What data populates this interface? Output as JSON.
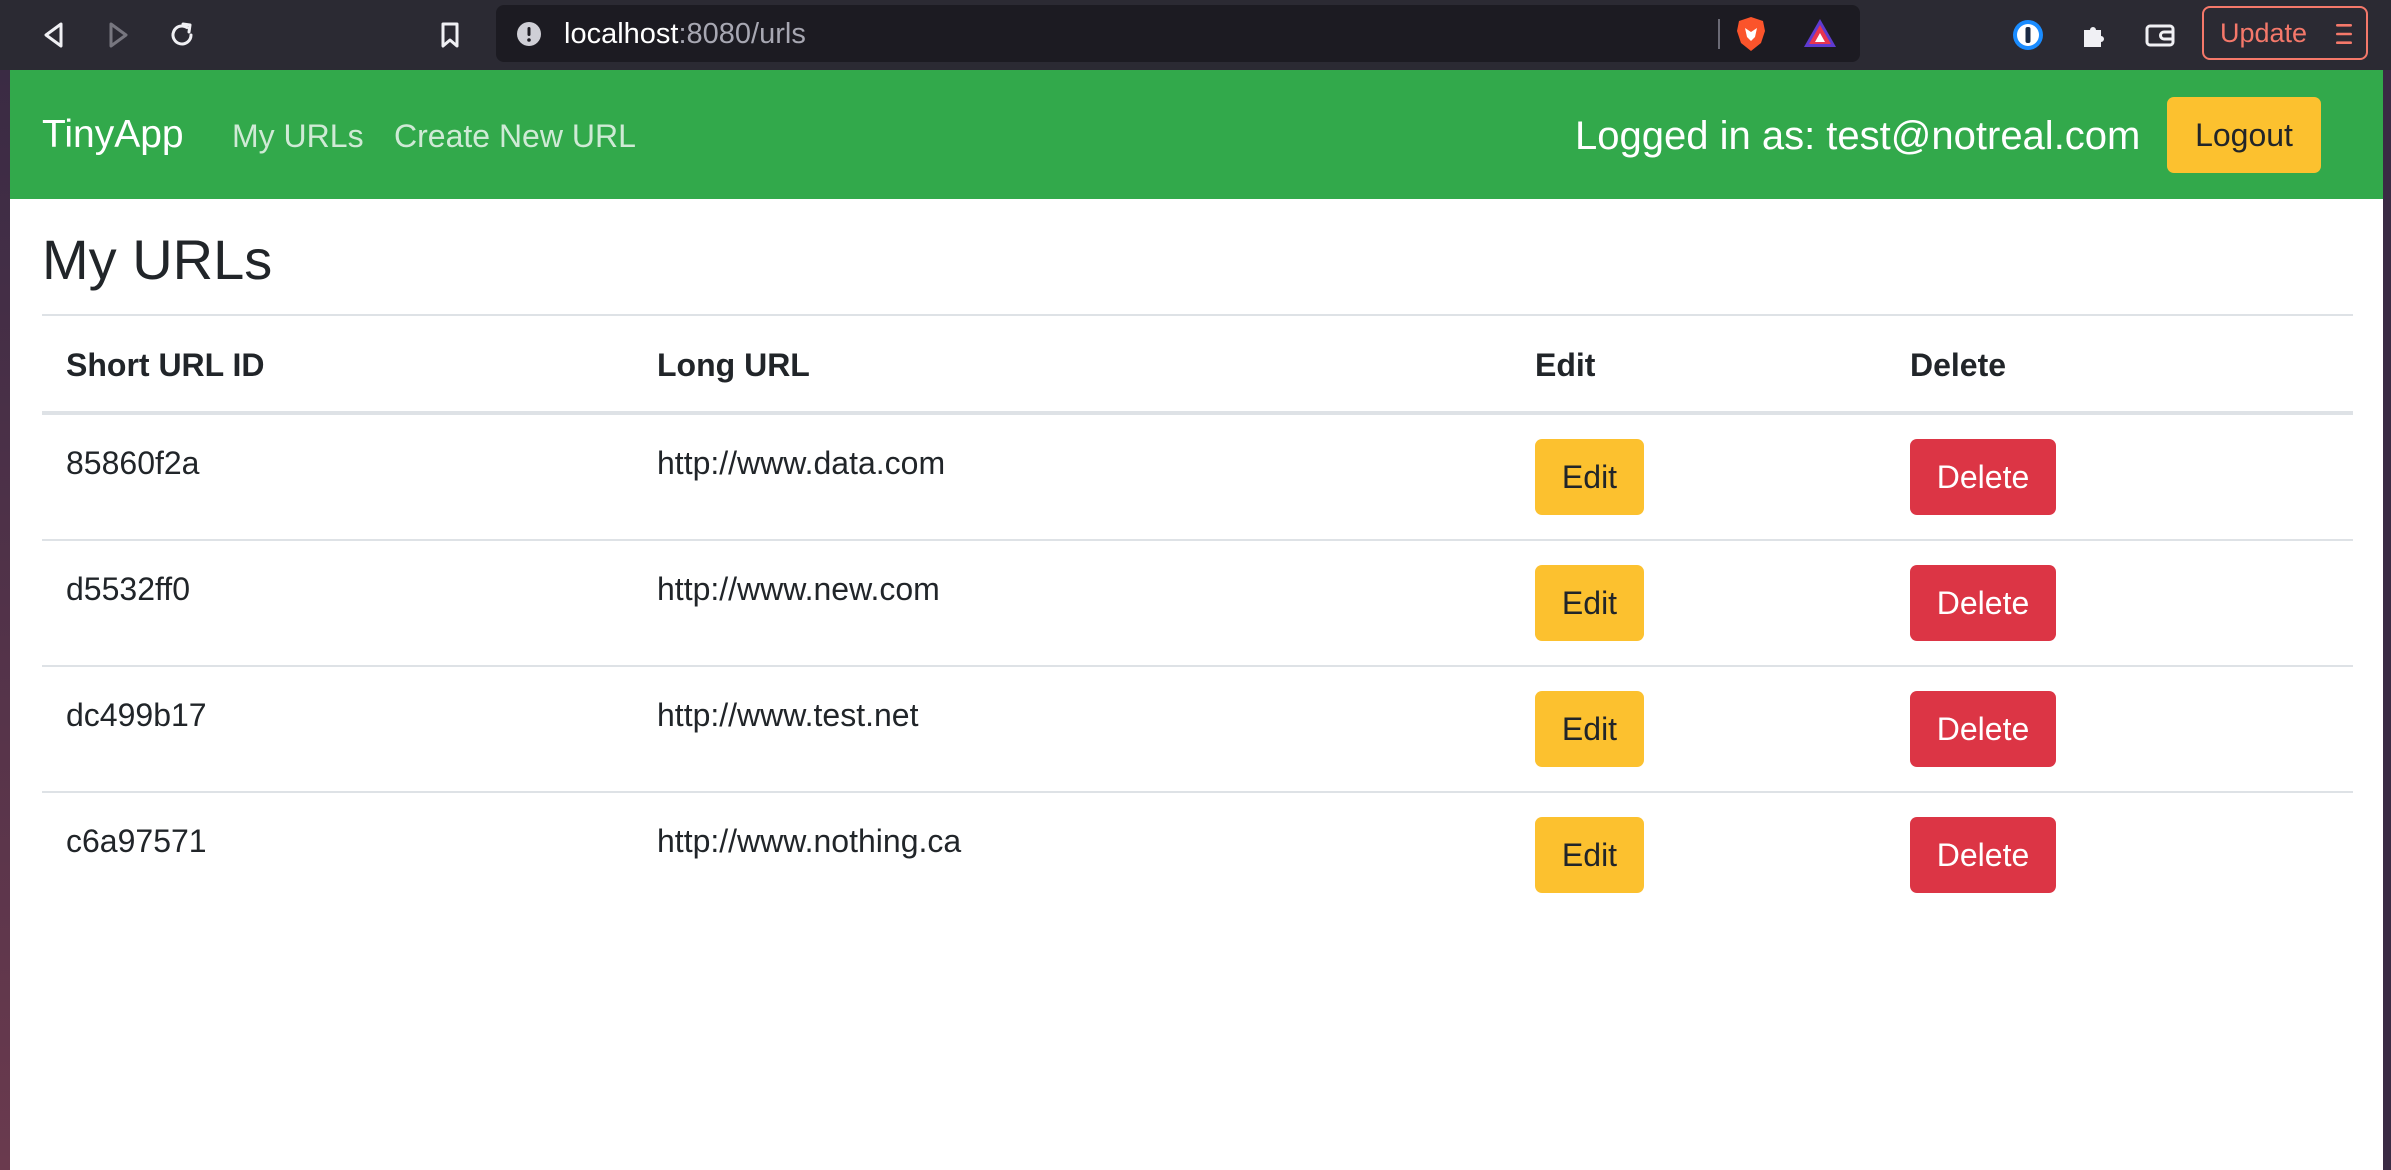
{
  "browser": {
    "url_host": "localhost",
    "url_rest": ":8080/urls",
    "update_label": "Update"
  },
  "navbar": {
    "brand": "TinyApp",
    "links": [
      "My URLs",
      "Create New URL"
    ],
    "logged_in_text": "Logged in as: test@notreal.com",
    "logout_label": "Logout",
    "color": "#32a94b"
  },
  "main": {
    "title": "My URLs",
    "columns": [
      "Short URL ID",
      "Long URL",
      "Edit",
      "Delete"
    ],
    "rows": [
      {
        "short_id": "85860f2a",
        "long_url": "http://www.data.com",
        "edit_label": "Edit",
        "delete_label": "Delete"
      },
      {
        "short_id": "d5532ff0",
        "long_url": "http://www.new.com",
        "edit_label": "Edit",
        "delete_label": "Delete"
      },
      {
        "short_id": "dc499b17",
        "long_url": "http://www.test.net",
        "edit_label": "Edit",
        "delete_label": "Delete"
      },
      {
        "short_id": "c6a97571",
        "long_url": "http://www.nothing.ca",
        "edit_label": "Edit",
        "delete_label": "Delete"
      }
    ]
  },
  "colors": {
    "warning": "#fcc12f",
    "danger": "#dc3545",
    "chrome": "#2b2a33"
  },
  "icons": [
    "back-icon",
    "forward-icon",
    "reload-icon",
    "bookmark-icon",
    "site-info-icon",
    "brave-shields-icon",
    "brave-rewards-icon",
    "password-manager-icon",
    "extensions-icon",
    "wallet-icon",
    "menu-icon"
  ]
}
